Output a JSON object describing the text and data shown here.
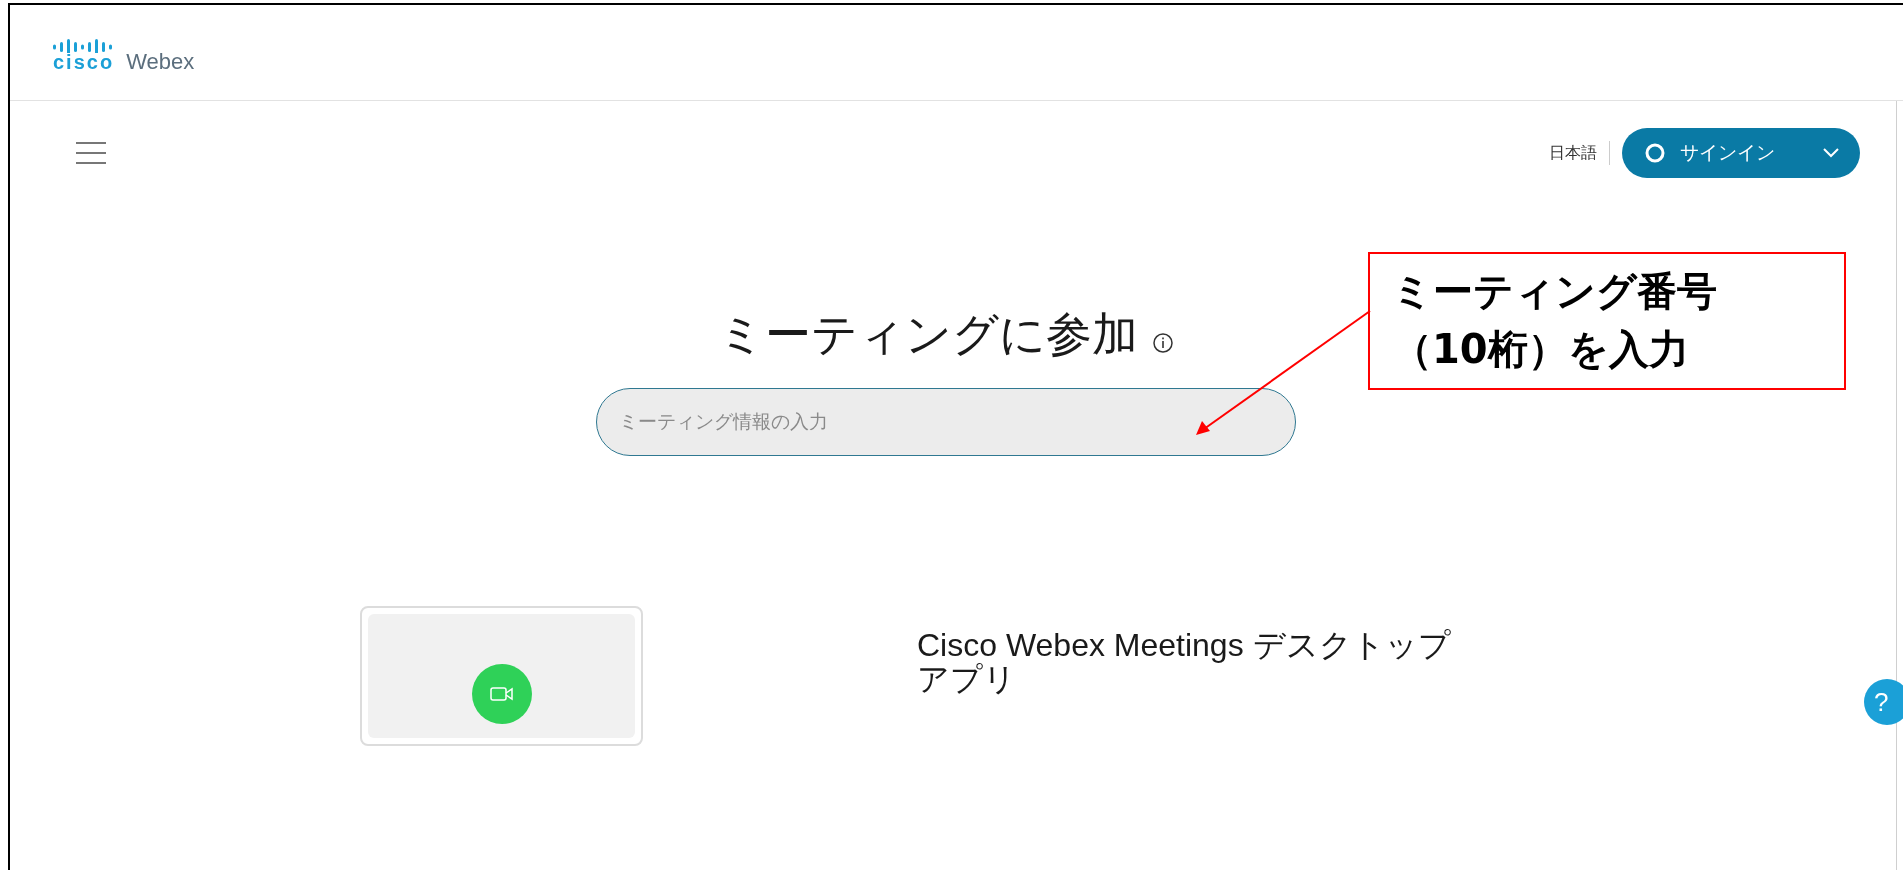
{
  "header": {
    "logo_mark": "cisco",
    "logo_product": "Webex"
  },
  "topbar": {
    "language": "日本語",
    "signin": {
      "label": "サインイン"
    }
  },
  "join": {
    "title": "ミーティングに参加",
    "search": {
      "placeholder": "ミーティング情報の入力"
    }
  },
  "help": {
    "label": "?"
  },
  "annotation": {
    "lines": [
      "ミーティング番号",
      "（10桁）を入力"
    ]
  },
  "app_section": {
    "title_lines": [
      "Cisco Webex Meetings デスクトップ",
      "アプリ"
    ]
  }
}
